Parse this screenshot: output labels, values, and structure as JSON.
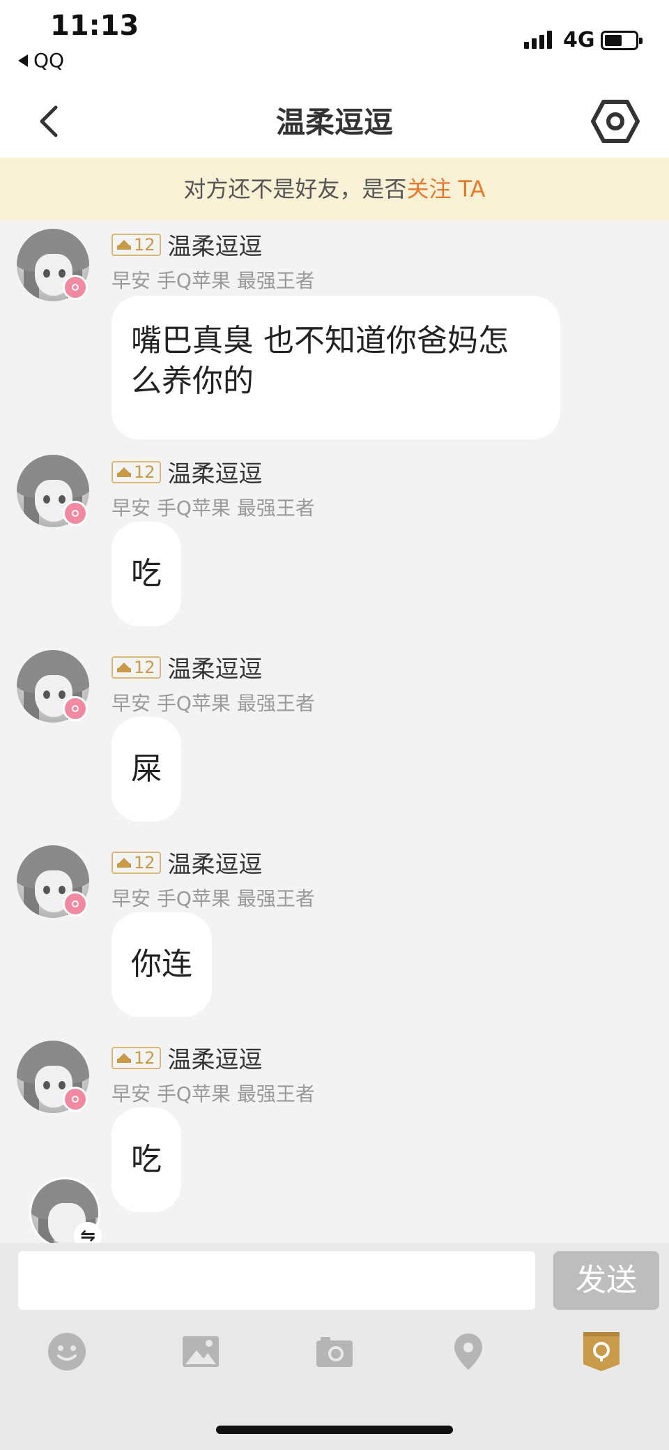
{
  "status_bar": {
    "time": "11:13",
    "back_app": "QQ",
    "network": "4G"
  },
  "header": {
    "title": "温柔逗逗"
  },
  "banner": {
    "text": "对方还不是好友，是否",
    "link": "关注 TA"
  },
  "messages": [
    {
      "level": "12",
      "name": "温柔逗逗",
      "tags": "早安 手Q苹果 最强王者",
      "text_line1": "嘴巴真臭 也不知道你爸妈怎",
      "text_line2": "么养你的"
    },
    {
      "level": "12",
      "name": "温柔逗逗",
      "tags": "早安 手Q苹果 最强王者",
      "text": "吃"
    },
    {
      "level": "12",
      "name": "温柔逗逗",
      "tags": "早安 手Q苹果 最强王者",
      "text": "屎"
    },
    {
      "level": "12",
      "name": "温柔逗逗",
      "tags": "早安 手Q苹果 最强王者",
      "text": "你连"
    },
    {
      "level": "12",
      "name": "温柔逗逗",
      "tags": "早安 手Q苹果 最强王者",
      "text": "吃"
    }
  ],
  "composer": {
    "placeholder": "",
    "send_label": "发送"
  },
  "toolbar": {
    "icons": [
      "emoji-icon",
      "image-icon",
      "camera-icon",
      "location-icon",
      "red-packet-icon"
    ]
  },
  "colors": {
    "accent": "#e37a2e",
    "banner_bg": "#f8f1d5",
    "level_gold": "#c89a4a",
    "gender_pink": "#f18aa0",
    "toolbar_icon": "#b5b5b5",
    "packet_gold": "#c89a4a"
  }
}
